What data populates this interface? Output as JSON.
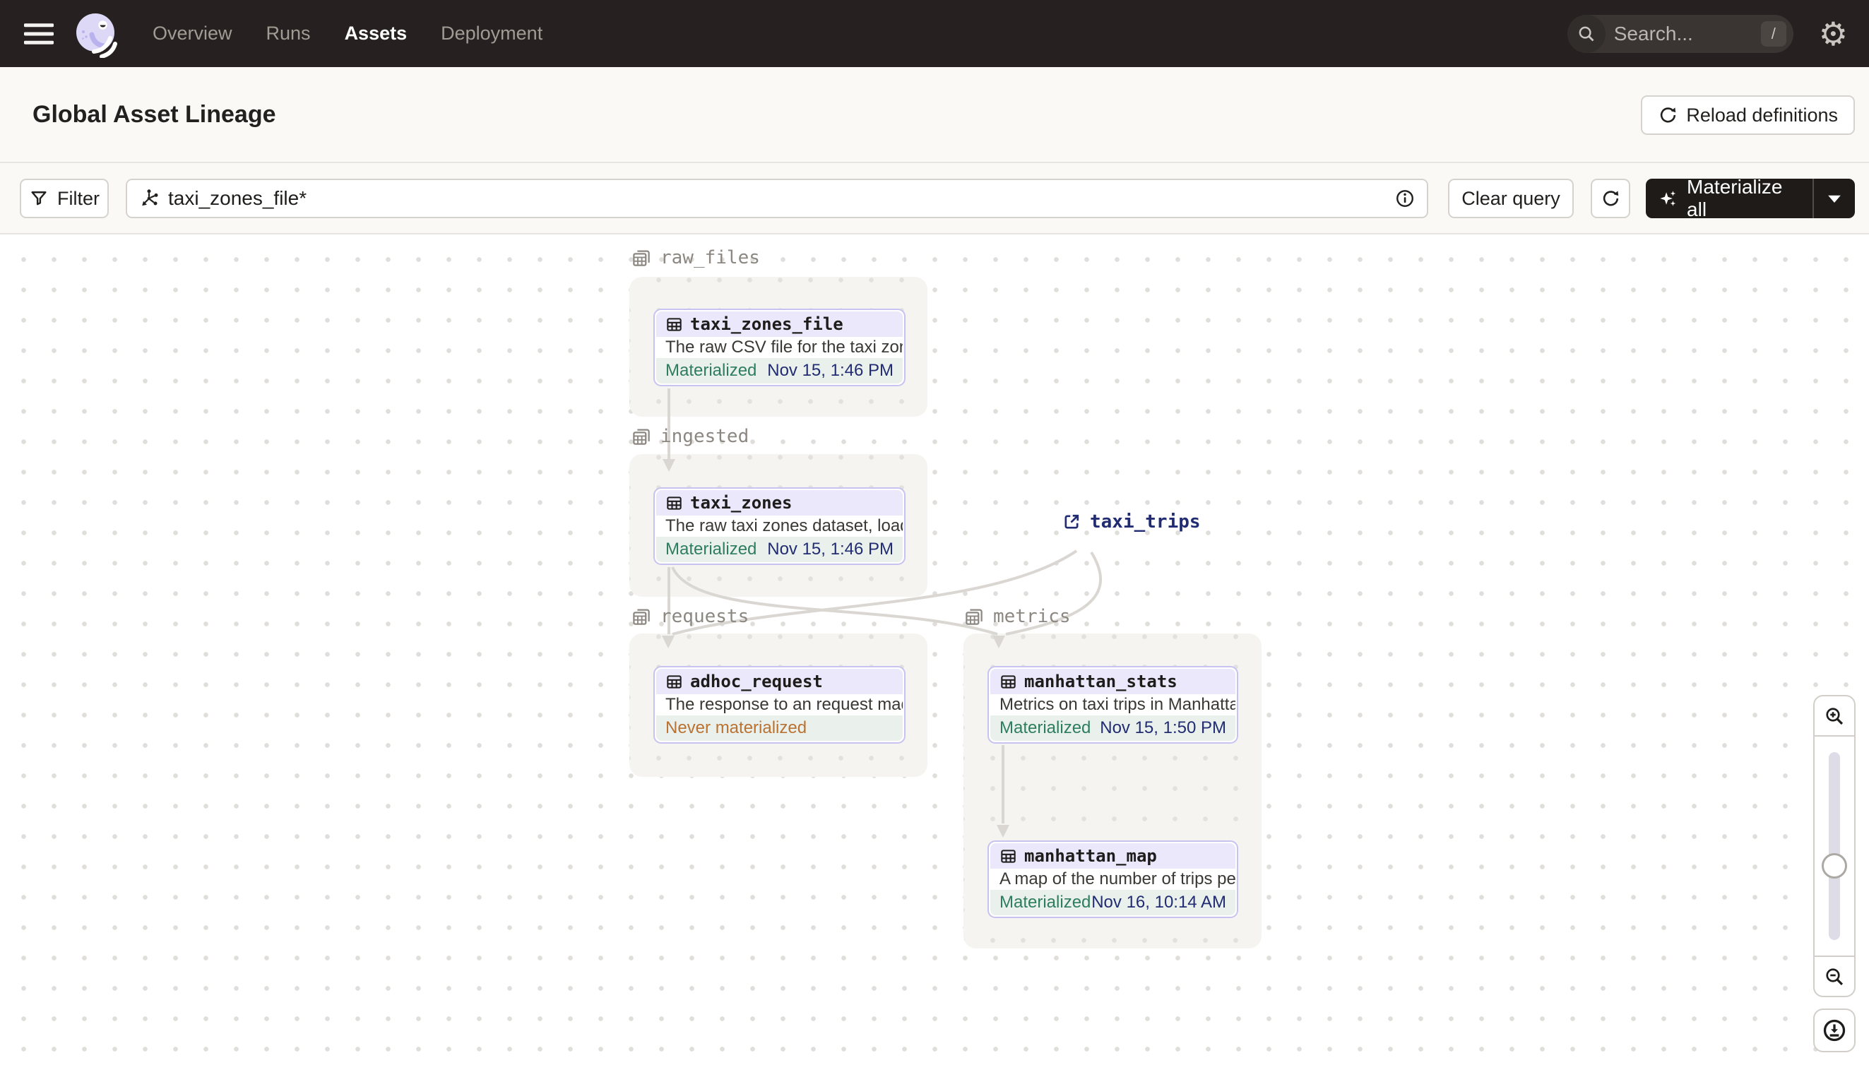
{
  "nav": {
    "links": [
      {
        "label": "Overview",
        "active": false
      },
      {
        "label": "Runs",
        "active": false
      },
      {
        "label": "Assets",
        "active": true
      },
      {
        "label": "Deployment",
        "active": false
      }
    ],
    "search": {
      "placeholder": "Search...",
      "shortcut": "/"
    }
  },
  "header": {
    "title": "Global Asset Lineage",
    "reload_button_label": "Reload definitions"
  },
  "toolbar": {
    "filter_label": "Filter",
    "query_value": "taxi_zones_file*",
    "clear_query_label": "Clear query",
    "materialize_label": "Materialize all"
  },
  "graph": {
    "groups": [
      {
        "name": "raw_files"
      },
      {
        "name": "ingested"
      },
      {
        "name": "requests"
      },
      {
        "name": "metrics"
      }
    ],
    "nodes": [
      {
        "title": "taxi_zones_file",
        "group": "raw_files",
        "description": "The raw CSV file for the taxi zones dat...",
        "status": "Materialized",
        "timestamp": "Nov 15, 1:46 PM"
      },
      {
        "title": "taxi_zones",
        "group": "ingested",
        "description": "The raw taxi zones dataset, loaded int...",
        "status": "Materialized",
        "timestamp": "Nov 15, 1:46 PM"
      },
      {
        "title": "adhoc_request",
        "group": "requests",
        "description": "The response to an request made in th...",
        "status": "Never materialized",
        "timestamp": ""
      },
      {
        "title": "manhattan_stats",
        "group": "metrics",
        "description": "Metrics on taxi trips in Manhattan",
        "status": "Materialized",
        "timestamp": "Nov 15, 1:50 PM"
      },
      {
        "title": "manhattan_map",
        "group": "metrics",
        "description": "A map of the number of trips per taxi z...",
        "status": "Materialized",
        "timestamp": "Nov 16, 10:14 AM"
      }
    ],
    "external_assets": [
      {
        "label": "taxi_trips"
      }
    ],
    "edges": [
      {
        "from": "taxi_zones_file",
        "to": "taxi_zones"
      },
      {
        "from": "taxi_zones",
        "to": "adhoc_request"
      },
      {
        "from": "taxi_zones",
        "to": "manhattan_stats"
      },
      {
        "from": "taxi_trips",
        "to": "adhoc_request"
      },
      {
        "from": "taxi_trips",
        "to": "manhattan_stats"
      },
      {
        "from": "manhattan_stats",
        "to": "manhattan_map"
      }
    ]
  },
  "colors": {
    "nav_bg": "#262120",
    "accent_purple": "#C7C3F1",
    "node_header_bg": "#EAE8FA",
    "materialized_green": "#2E7D5E",
    "never_materialized_orange": "#BA7233",
    "timestamp_navy": "#222C72",
    "edge_gray": "#DAD7D3",
    "group_box_bg": "#F5F4F1",
    "dark_button_bg": "#1F1B18"
  }
}
